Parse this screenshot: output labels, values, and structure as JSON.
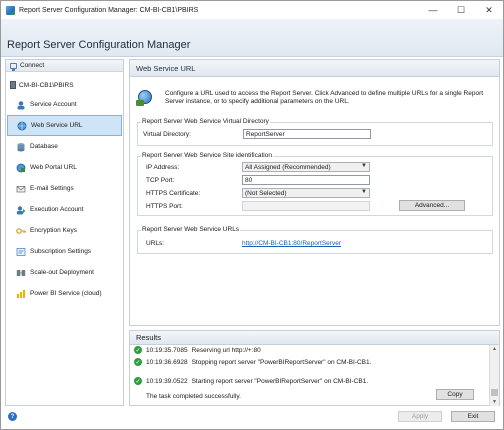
{
  "window": {
    "title": "Report Server Configuration Manager: CM-BI-CB1\\PBIRS"
  },
  "banner": {
    "title": "Report Server Configuration Manager"
  },
  "sidebar": {
    "connect_label": "Connect",
    "server_name": "CM-BI-CB1\\PBIRS",
    "items": [
      {
        "label": "Service Account",
        "icon": "service-account-icon"
      },
      {
        "label": "Web Service URL",
        "icon": "web-service-url-icon",
        "selected": true
      },
      {
        "label": "Database",
        "icon": "database-icon"
      },
      {
        "label": "Web Portal URL",
        "icon": "web-portal-url-icon"
      },
      {
        "label": "E-mail Settings",
        "icon": "email-icon"
      },
      {
        "label": "Execution Account",
        "icon": "execution-account-icon"
      },
      {
        "label": "Encryption Keys",
        "icon": "key-icon"
      },
      {
        "label": "Subscription Settings",
        "icon": "subscription-icon"
      },
      {
        "label": "Scale-out Deployment",
        "icon": "scale-out-icon"
      },
      {
        "label": "Power BI Service (cloud)",
        "icon": "power-bi-icon"
      }
    ]
  },
  "main": {
    "header": "Web Service URL",
    "intro": "Configure a URL used to access the Report Server. Click Advanced to define multiple URLs for a single Report Server instance, or to specify additional parameters on the URL.",
    "virtual_directory": {
      "group_title": "Report Server Web Service Virtual Directory",
      "label": "Virtual Directory:",
      "value": "ReportServer"
    },
    "site_identification": {
      "group_title": "Report Server Web Service Site identification",
      "ip_label": "IP Address:",
      "ip_value": "All Assigned (Recommended)",
      "tcp_label": "TCP Port:",
      "tcp_value": "80",
      "cert_label": "HTTPS Certificate:",
      "cert_value": "(Not Selected)",
      "https_port_label": "HTTPS Port:",
      "https_port_value": "",
      "advanced_label": "Advanced..."
    },
    "urls": {
      "group_title": "Report Server Web Service URLs",
      "label": "URLs:",
      "value": "http://CM-BI-CB1:80/ReportServer"
    }
  },
  "results": {
    "header": "Results",
    "rows": [
      {
        "time": "10:19:35.7085",
        "text": "Reserving url http://+:80"
      },
      {
        "time": "10:19:36.6928",
        "text": "Stopping report server \"PowerBIReportServer\" on CM-BI-CB1."
      },
      {
        "time": "10:19:39.0522",
        "text": "Starting report server \"PowerBIReportServer\" on CM-BI-CB1."
      }
    ],
    "completed": "The task completed successfully.",
    "copy_label": "Copy"
  },
  "footer": {
    "apply_label": "Apply",
    "exit_label": "Exit"
  },
  "colors": {
    "accent": "#1a5fb4",
    "selection": "#cfe4f7",
    "success": "#2f9e3f"
  }
}
